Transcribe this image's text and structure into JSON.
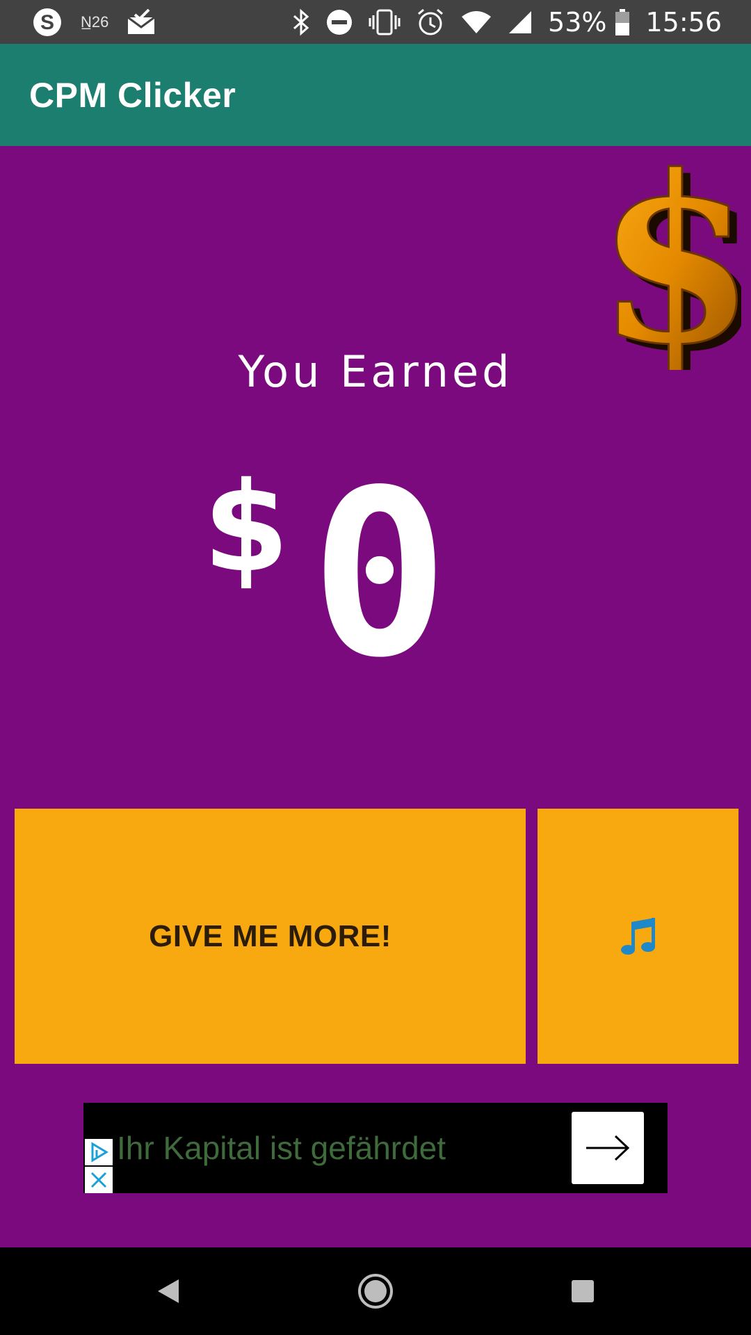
{
  "status_bar": {
    "carrier_mark": "N̲26",
    "battery": "53%",
    "time": "15:56"
  },
  "app_bar": {
    "title": "CPM Clicker"
  },
  "main": {
    "earned_label": "You Earned",
    "currency_symbol": "$",
    "amount": "0",
    "give_button_label": "GIVE ME MORE!",
    "music_button_icon": "music-note-icon"
  },
  "ad": {
    "text": "Ihr Kapital ist gefährdet"
  },
  "colors": {
    "background": "#7a0a7d",
    "app_bar": "#1b7e6e",
    "status_bar": "#424242",
    "button": "#f8a90f",
    "ad_text": "#3f6b3c"
  }
}
